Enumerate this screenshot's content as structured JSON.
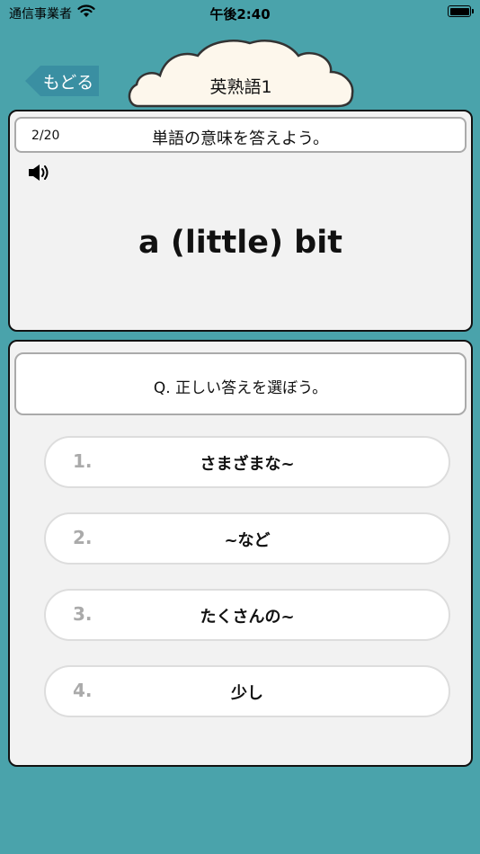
{
  "status": {
    "carrier": "通信事業者",
    "time": "午後2:40"
  },
  "nav": {
    "back_label": "もどる",
    "title": "英熟語1"
  },
  "word_card": {
    "progress": "2/20",
    "instruction": "単語の意味を答えよう。",
    "word": "a (little) bit"
  },
  "answer_card": {
    "question": "Q. 正しい答えを選ぼう。",
    "choices": [
      {
        "number": "1.",
        "label": "さまざまな~"
      },
      {
        "number": "2.",
        "label": "~など"
      },
      {
        "number": "3.",
        "label": "たくさんの~"
      },
      {
        "number": "4.",
        "label": "少し"
      }
    ]
  },
  "colors": {
    "background": "#4aa3ab",
    "back_button": "#3a8fa2",
    "cloud": "#fdf7ec"
  },
  "icons": {
    "wifi": "wifi-icon",
    "battery": "battery-icon",
    "speaker": "speaker-icon",
    "back_arrow": "arrow-left-icon"
  }
}
